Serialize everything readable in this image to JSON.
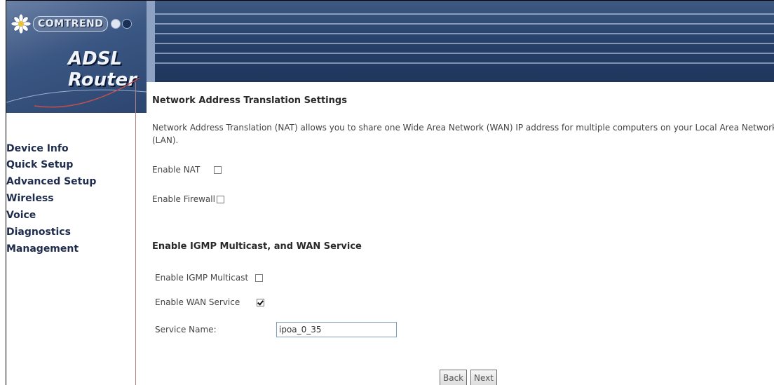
{
  "brand": {
    "company": "COMTREND",
    "product": "ADSL Router"
  },
  "sidebar": {
    "items": [
      {
        "label": "Device Info"
      },
      {
        "label": "Quick Setup"
      },
      {
        "label": "Advanced Setup"
      },
      {
        "label": "Wireless"
      },
      {
        "label": "Voice"
      },
      {
        "label": "Diagnostics"
      },
      {
        "label": "Management"
      }
    ]
  },
  "main": {
    "title": "Network Address Translation Settings",
    "description": "Network Address Translation (NAT) allows you to share one Wide Area Network (WAN) IP address for multiple computers on your Local Area Network (LAN).",
    "enable_nat": {
      "label": "Enable NAT",
      "checked": false
    },
    "enable_firewall": {
      "label": "Enable Firewall",
      "checked": false
    },
    "igmp_section_title": "Enable IGMP Multicast, and WAN Service",
    "enable_igmp": {
      "label": "Enable IGMP Multicast",
      "checked": false
    },
    "enable_wan_service": {
      "label": "Enable WAN Service",
      "checked": true
    },
    "service_name": {
      "label": "Service Name:",
      "value": "ipoa_0_35"
    },
    "buttons": {
      "back": "Back",
      "next": "Next"
    }
  },
  "colors": {
    "banner": "#27426c",
    "menu_text": "#1e2c4d"
  }
}
